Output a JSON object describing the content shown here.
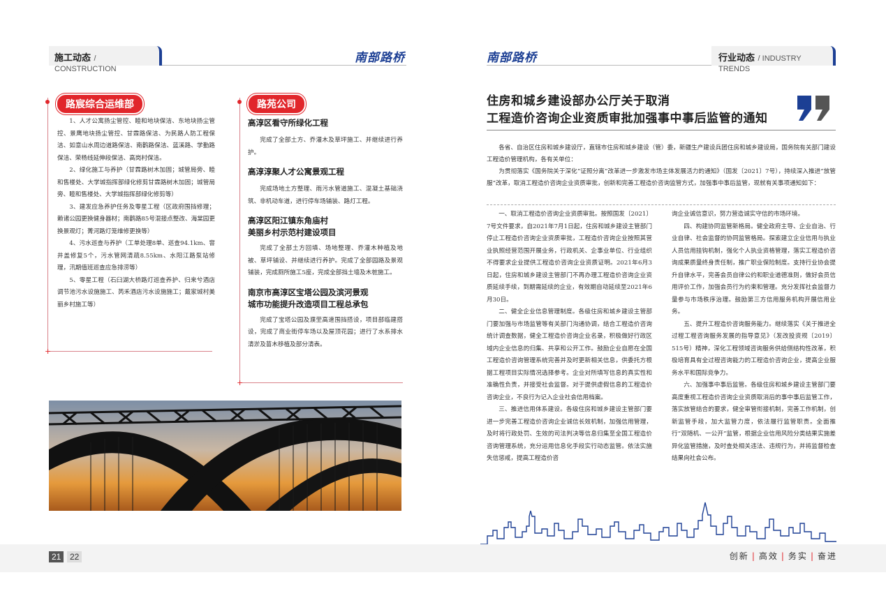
{
  "left": {
    "header": {
      "title": "施工动态",
      "subtitle": "/ CONSTRUCTION",
      "brand": "南部路桥"
    },
    "col1": {
      "tag": "路宸综合运维部",
      "paragraphs": [
        "1、人才公寓扬尘管控、睦和地块保洁、东地块扬尘管控、景鹰地块扬尘管控、甘霖路保洁、为民路人防工程保洁、如意山水周边道路保洁、南鹳路保洁、蓝溪路、学勤路保洁、荣杨线延伸段保洁、高岗村保洁。",
        "2、绿化施工与养护（甘霖路树木加固；城管局旁、睦和售楼处、大学城指挥部绿化修剪甘霖路树木加固；城管局旁、睦和售楼处、大学城指挥部绿化修剪等）",
        "3、建发应急养护任务及零星工程（区政府围挡修理；赖诸公园更换健身器材；南鹳路85号混接点整改、海棠园更换景观灯；菁河路灯笼维修更换等）",
        "4、污水巡查与养护（工单处理8单、巡查94.1km、窨井盖修复5个，污水管网清疏8.55km、水阳江路泵站修理，汛期值班巡查应急排涝等）",
        "5、零星工程（石臼湖大桥路灯巡查养护、归来兮酒店调节池污水设施施工、芮禾酒店污水设施施工；戴家城村美丽乡村施工等）"
      ]
    },
    "col2": {
      "tag": "路苑公司",
      "items": [
        {
          "heading": "高淳区看守所绿化工程",
          "heading2": "",
          "text": "完成了全部土方、乔灌木及草坪施工、并继续进行养护。"
        },
        {
          "heading": "高淳淳聚人才公寓景观工程",
          "heading2": "",
          "text": "完成场地土方整理、雨污水管道施工、混凝土基础浇筑、非机动车道，进行停车场铺装、路灯工程。"
        },
        {
          "heading": "高淳区阳江镇东角庙村",
          "heading2": "美丽乡村示范村建设项目",
          "text": "完成了全部土方回填、场地整理、乔灌木种植及地被、草坪铺设、并继续进行养护。完成了全部园路及景观铺装，完成厕所施工5座，完成全部挡土墙及木桩施工。"
        },
        {
          "heading": "南京市高淳区宝塔公园及滨河景观",
          "heading2": "城市功能提升改造项目工程总承包",
          "text": "完成了宝塔公园及濮茔高速围挡搭设，项目部临建搭设，完成了商业街停车场以及屋顶花园；进行了水系排水清淤及苗木移植及部分清表。"
        }
      ]
    },
    "page_number": "21"
  },
  "right": {
    "header": {
      "title": "行业动态",
      "subtitle": "/ INDUSTRY TRENDS",
      "brand": "南部路桥"
    },
    "article": {
      "title_line1": "住房和城乡建设部办公厅关于取消",
      "title_line2": "工程造价咨询企业资质审批加强事中事后监管的通知",
      "intro": [
        "各省、自治区住房和城乡建设厅，直辖市住房和城乡建设（管）委，新疆生产建设兵团住房和城乡建设局，国务院有关部门建设工程造价管理机构，各有关单位：",
        "为贯彻落实《国务院关于深化“证照分离”改革进一步激发市场主体发展活力的通知》（国发〔2021〕7号），持续深入推进“放管服”改革，取消工程造价咨询企业资质审批，创新和完善工程造价咨询监管方式，加强事中事后监管，现就有关事项通知如下："
      ],
      "col_a": [
        "一、取消工程造价咨询企业资质审批。按照国发〔2021〕7号文件要求，自2021年7月1日起，住房和城乡建设主管部门停止工程造价咨询企业资质审批，工程造价咨询企业按照其营业执照经营范围开展业务，行政机关、企事业单位、行业组织不得要求企业提供工程造价咨询企业资质证明。2021年6月3日起，住房和城乡建设主管部门不再办理工程造价咨询企业资质延续手续，到期需延续的企业，有效期自动延续至2021年6月30日。",
        "二、健全企业信息管理制度。各级住房和城乡建设主管部门要加强与市场监管等有关部门沟通协调，结合工程造价咨询统计调查数据，健全工程造价咨询企业名录，积极做好行政区域内企业信息的归集、共享和公开工作。鼓励企业自愿在全国工程造价咨询管理系统完善并及时更新相关信息，供委托方根据工程项目实际情况选择参考。企业对所填写信息的真实性和准确性负责，并接受社会监督。对于提供虚假信息的工程造价咨询企业，不良行为记入企业社会信用档案。",
        "三、推进信用体系建设。各级住房和城乡建设主管部门要进一步完善工程造价咨询企业诚信长效机制，加强信用管理，及时将行政处罚、生效的司法判决等信息归集至全国工程造价咨询管理系统，充分运用信息化手段实行动态监管。依法实施失信惩戒，提高工程造价咨"
      ],
      "col_b": [
        "询企业诚信意识，努力营造诚实守信的市场环境。",
        "四、构建协同监管新格局。健全政府主导、企业自治、行业自律、社会监督的协同监管格局。探索建立企业信用与执业人员信用挂钩机制，强化个人执业资格管理，落实工程造价咨询成果质量终身责任制，推广职业保险制度。支持行业协会提升自律水平，完善会员自律公约和职业道德准则，做好会员信用评价工作，加强会员行为约束和管理。充分发挥社会监督力量参与市场秩序治理。鼓励第三方信用服务机构开展信用业务。",
        "五、提升工程造价咨询服务能力。继续落实《关于推进全过程工程咨询服务发展的指导意见》（发改投资规〔2019〕515号）精神，深化工程领域咨询服务供给侧结构性改革，积极培育具有全过程咨询能力的工程造价咨询企业，提高企业服务水平和国际竞争力。",
        "六、加强事中事后监管。各级住房和城乡建设主管部门要高度重视工程造价咨询企业资质取消后的事中事后监管工作，落实放管结合的要求，健全审管衔接机制，完善工作机制，创新监管手段，加大监管力度，依法履行监管职责。全面推行“双随机、一公开”监管，根据企业信用风险分类结果实施差异化监管措施，及时查处相关违法、违规行为，并将监督检查结果向社会公布。"
      ]
    },
    "page_number": "22",
    "slogan": [
      "创新",
      "高效",
      "务实",
      "奋进"
    ]
  },
  "colors": {
    "brand_blue": "#1c3f94",
    "accent_red": "#e1262b"
  }
}
